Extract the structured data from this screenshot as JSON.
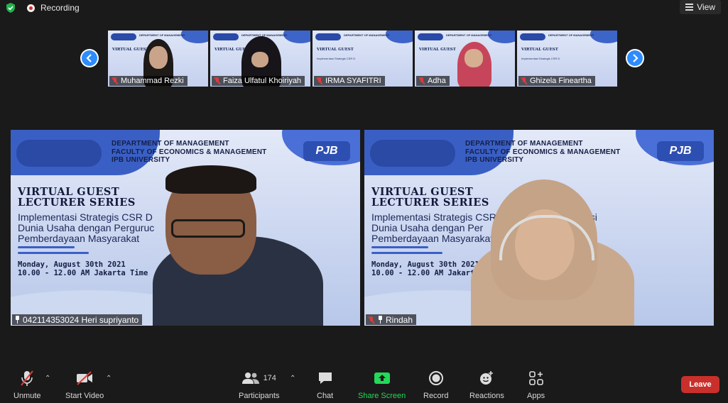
{
  "window": {
    "recording_label": "Recording",
    "view_label": "View"
  },
  "gallery": {
    "prev_label": "‹",
    "next_label": "›",
    "thumbnails": [
      {
        "name": "Muhammad Rezki"
      },
      {
        "name": "Faiza Ulfatul Khoiriyah"
      },
      {
        "name": "IRMA SYAFITRI"
      },
      {
        "name": "Adha"
      },
      {
        "name": "Ghizela Fineartha"
      }
    ]
  },
  "slide": {
    "dept_line1": "DEPARTMENT OF MANAGEMENT",
    "dept_line2": "FACULTY OF ECONOMICS & MANAGEMENT",
    "dept_line3": "IPB UNIVERSITY",
    "title_line1": "VIRTUAL GUEST",
    "title_line2": "LECTURER SERIES",
    "left_topic_line1": "Implementasi Strategis CSR D",
    "left_topic_line2": "Dunia Usaha dengan Perguruc",
    "left_topic_line3": "Pemberdayaan Masyarakat",
    "right_topic_line1": "Implementasi Strategis CSR",
    "right_topic_line1_tail": "asi",
    "right_topic_line2": "Dunia Usaha dengan Per",
    "right_topic_line3": "Pemberdayaan Masyarakat",
    "date_line1": "Monday, August 30th 2021",
    "date_line2": "10.00 - 12.00 AM Jakarta Time",
    "pjb_logo": "PJB"
  },
  "speakers": [
    {
      "name": "042114353024 Heri supriyanto"
    },
    {
      "name": "Rindah"
    }
  ],
  "toolbar": {
    "unmute_label": "Unmute",
    "start_video_label": "Start Video",
    "participants_label": "Participants",
    "participants_count": "174",
    "chat_label": "Chat",
    "share_screen_label": "Share Screen",
    "record_label": "Record",
    "reactions_label": "Reactions",
    "apps_label": "Apps",
    "leave_label": "Leave"
  },
  "colors": {
    "share_green": "#23d959",
    "leave_red": "#c9302c",
    "accent_blue": "#2d8cff",
    "mic_off_red": "#e03a3a"
  },
  "icons": [
    "shield-check-icon",
    "record-dot-icon",
    "grid-view-icon",
    "chevron-left-icon",
    "chevron-right-icon",
    "mic-off-icon",
    "video-off-icon",
    "participants-icon",
    "chat-icon",
    "share-screen-icon",
    "record-icon",
    "reactions-icon",
    "apps-icon",
    "pin-icon"
  ]
}
